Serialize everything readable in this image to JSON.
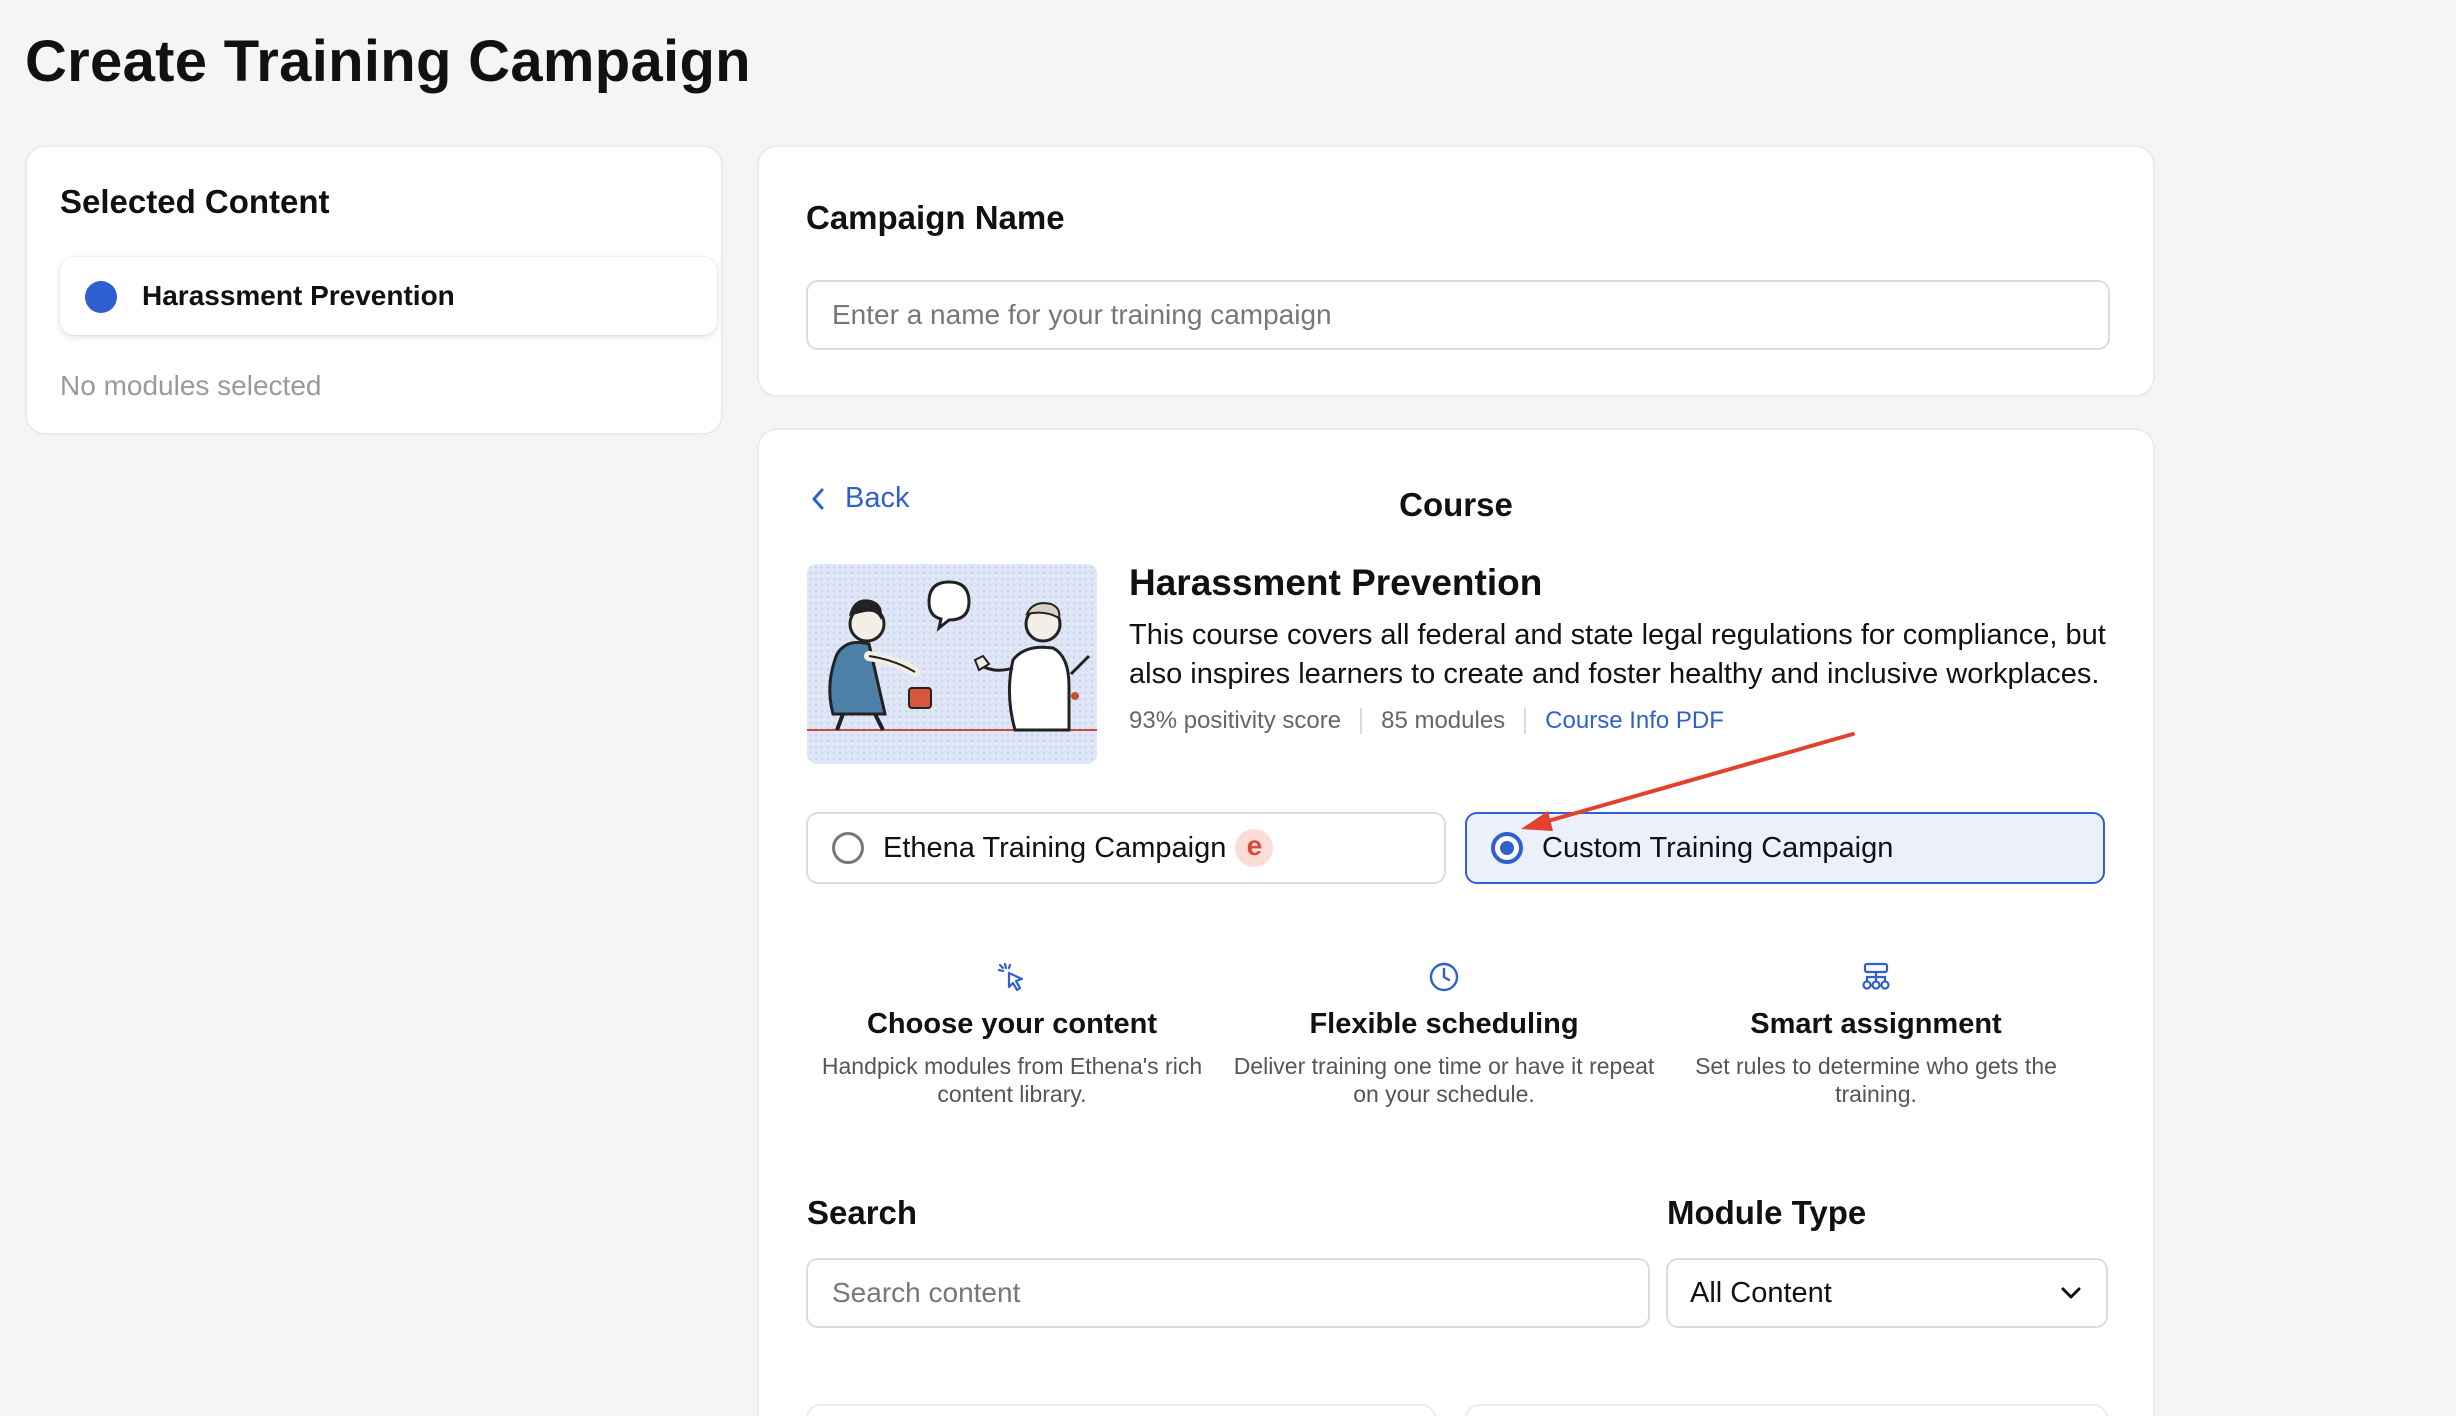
{
  "page": {
    "title": "Create Training Campaign"
  },
  "selected_content": {
    "title": "Selected Content",
    "item_label": "Harassment Prevention",
    "item_color": "#2f5fd0",
    "empty_text": "No modules selected"
  },
  "campaign_name": {
    "label": "Campaign Name",
    "placeholder": "Enter a name for your training campaign",
    "value": ""
  },
  "course": {
    "back_label": "Back",
    "heading": "Course",
    "title": "Harassment Prevention",
    "description": "This course covers all federal and state legal regulations for compliance, but also inspires learners to create and foster healthy and inclusive workplaces.",
    "positivity": "93% positivity score",
    "modules": "85 modules",
    "pdf_link": "Course Info PDF"
  },
  "campaign_types": [
    {
      "label": "Ethena Training Campaign",
      "badge": "e",
      "selected": false
    },
    {
      "label": "Custom Training Campaign",
      "selected": true
    }
  ],
  "features": [
    {
      "icon": "cursor-click-icon",
      "title": "Choose your content",
      "description": "Handpick modules from Ethena's rich content library."
    },
    {
      "icon": "clock-icon",
      "title": "Flexible scheduling",
      "description": "Deliver training one time or have it repeat on your schedule."
    },
    {
      "icon": "hierarchy-icon",
      "title": "Smart assignment",
      "description": "Set rules to determine who gets the training."
    }
  ],
  "search": {
    "label": "Search",
    "placeholder": "Search content",
    "value": ""
  },
  "module_type": {
    "label": "Module Type",
    "selected": "All Content"
  },
  "colors": {
    "accent": "#2f5fd0",
    "annotation_arrow": "#e2412e",
    "ethena_badge": "#d94a3a"
  }
}
